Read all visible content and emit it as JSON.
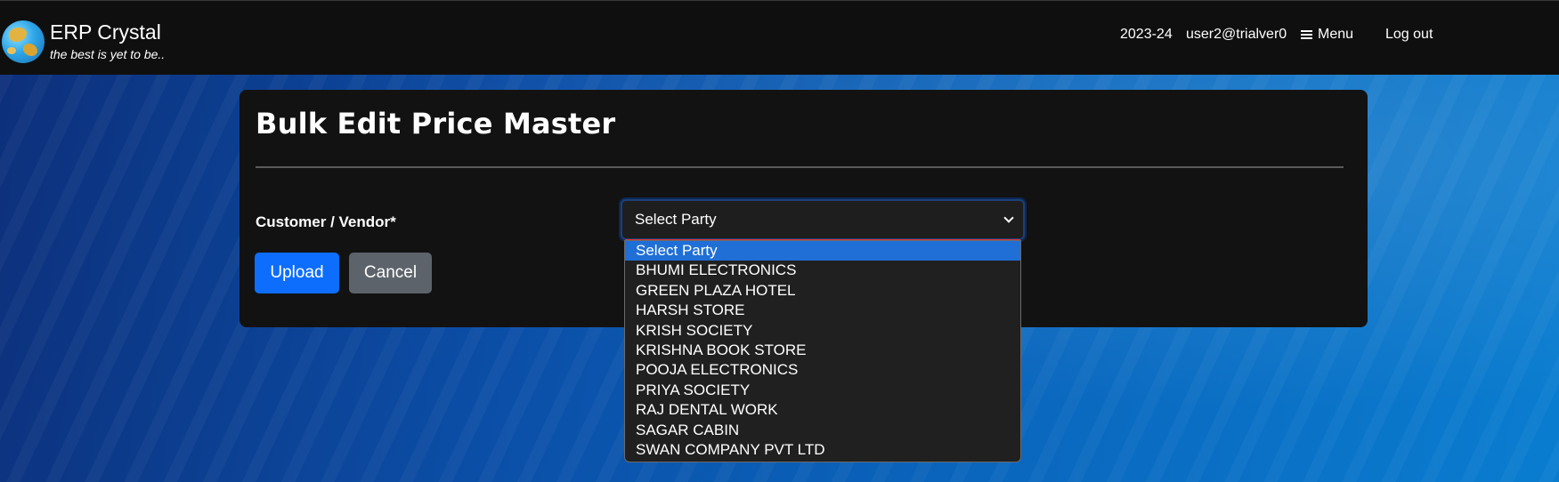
{
  "app": {
    "name": "ERP Crystal",
    "tagline": "the best is yet to be.."
  },
  "navbar": {
    "year": "2023-24",
    "user": "user2@trialver0",
    "menu_label": "Menu",
    "logout_label": "Log out",
    "icons": {
      "logo": "globe-icon",
      "menu": "hamburger-icon"
    }
  },
  "page": {
    "title": "Bulk Edit Price Master",
    "party_label": "Customer / Vendor*",
    "party_select": {
      "value": "Select Party",
      "options": [
        "Select Party",
        "BHUMI ELECTRONICS",
        "GREEN PLAZA HOTEL",
        "HARSH STORE",
        "KRISH SOCIETY",
        "KRISHNA BOOK STORE",
        "POOJA ELECTRONICS",
        "PRIYA SOCIETY",
        "RAJ DENTAL WORK",
        "SAGAR CABIN",
        "SWAN COMPANY PVT LTD"
      ],
      "highlighted_index": 0
    },
    "upload_label": "Upload",
    "cancel_label": "Cancel"
  },
  "colors": {
    "navbar_bg": "#0f0f0f",
    "card_bg": "#121212",
    "primary": "#0d6efd",
    "secondary": "#5c636a",
    "option_highlight": "#1f6fd6",
    "invalid_border": "#e03535"
  }
}
